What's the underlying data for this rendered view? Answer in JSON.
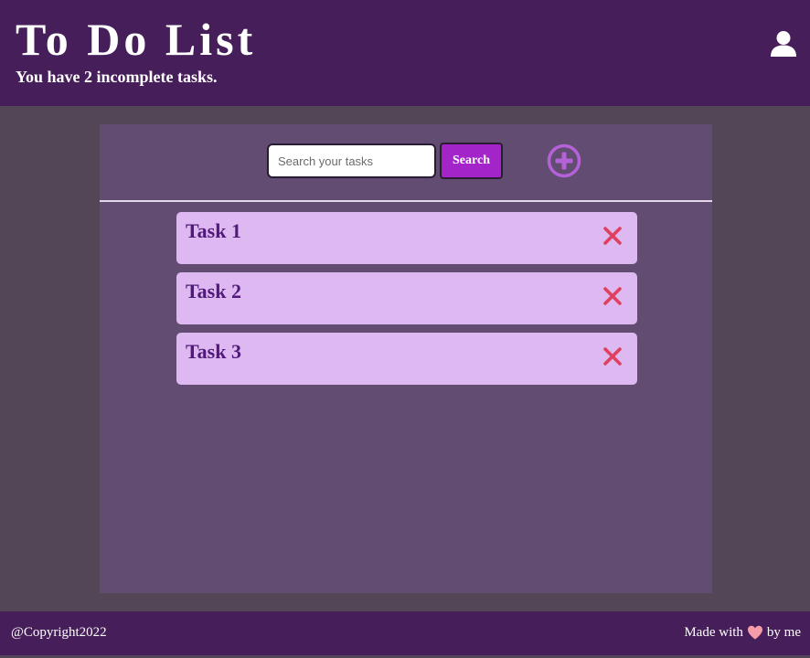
{
  "header": {
    "title": "To Do List",
    "subtitle": "You have 2 incomplete tasks.",
    "user_icon": "user-icon"
  },
  "search": {
    "placeholder": "Search your tasks",
    "value": "",
    "button_label": "Search",
    "add_icon": "add-circle-icon"
  },
  "tasks": [
    {
      "title": "Task 1",
      "delete_icon": "close-icon"
    },
    {
      "title": "Task 2",
      "delete_icon": "close-icon"
    },
    {
      "title": "Task 3",
      "delete_icon": "close-icon"
    }
  ],
  "footer": {
    "copyright": "@Copyright2022",
    "made_with_prefix": "Made with",
    "made_with_suffix": "by me",
    "heart_icon": "heart-icon"
  },
  "colors": {
    "header_bg": "#461e59",
    "page_bg": "#534657",
    "panel_bg": "#634c72",
    "task_bg": "#ddb8f1",
    "task_text": "#511a7a",
    "accent": "#a325c9",
    "delete": "#e0405e",
    "heart": "#f49ca8"
  }
}
